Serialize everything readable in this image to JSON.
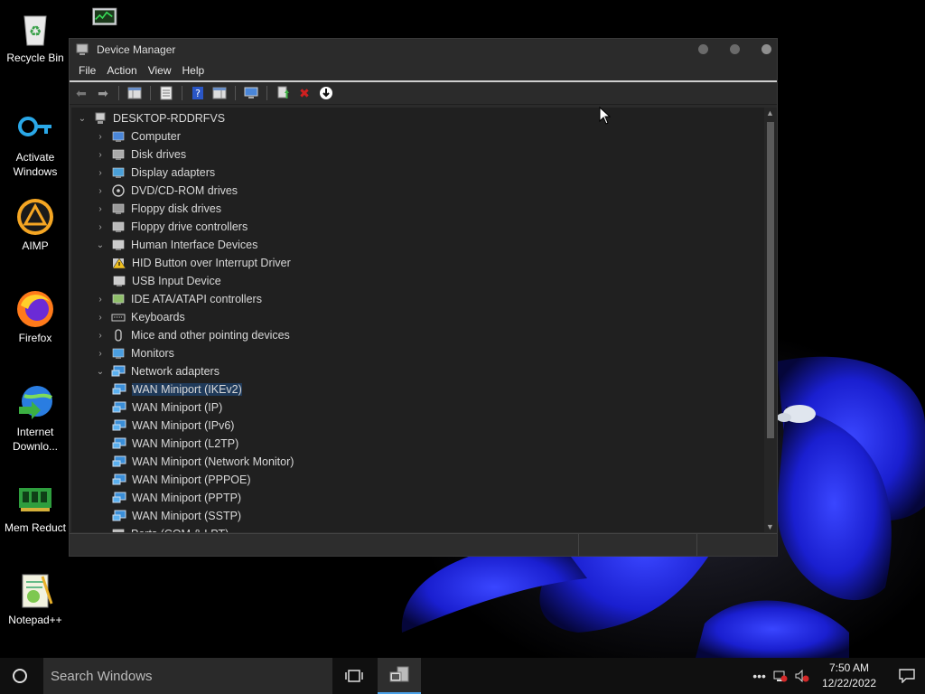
{
  "desktop": {
    "icons": [
      {
        "label": "Recycle Bin"
      },
      {
        "label": "Activate Windows"
      },
      {
        "label": "AIMP"
      },
      {
        "label": "Firefox"
      },
      {
        "label": "Internet Downlo..."
      },
      {
        "label": "Mem Reduct"
      },
      {
        "label": "Notepad++"
      }
    ]
  },
  "window": {
    "title": "Device Manager",
    "menu": [
      "File",
      "Action",
      "View",
      "Help"
    ],
    "tree": {
      "root": "DESKTOP-RDDRFVS",
      "items": [
        {
          "label": "Computer",
          "level": 1,
          "state": "collapsed",
          "icon": "computer-icon"
        },
        {
          "label": "Disk drives",
          "level": 1,
          "state": "collapsed",
          "icon": "disk-icon"
        },
        {
          "label": "Display adapters",
          "level": 1,
          "state": "collapsed",
          "icon": "display-icon"
        },
        {
          "label": "DVD/CD-ROM drives",
          "level": 1,
          "state": "collapsed",
          "icon": "dvd-icon"
        },
        {
          "label": "Floppy disk drives",
          "level": 1,
          "state": "collapsed",
          "icon": "floppy-icon"
        },
        {
          "label": "Floppy drive controllers",
          "level": 1,
          "state": "collapsed",
          "icon": "controller-icon"
        },
        {
          "label": "Human Interface Devices",
          "level": 1,
          "state": "expanded",
          "icon": "hid-icon"
        },
        {
          "label": "HID Button over Interrupt Driver",
          "level": 2,
          "state": "leaf",
          "icon": "warning-icon"
        },
        {
          "label": "USB Input Device",
          "level": 2,
          "state": "leaf",
          "icon": "hid-icon"
        },
        {
          "label": "IDE ATA/ATAPI controllers",
          "level": 1,
          "state": "collapsed",
          "icon": "ide-icon"
        },
        {
          "label": "Keyboards",
          "level": 1,
          "state": "collapsed",
          "icon": "keyboard-icon"
        },
        {
          "label": "Mice and other pointing devices",
          "level": 1,
          "state": "collapsed",
          "icon": "mouse-icon"
        },
        {
          "label": "Monitors",
          "level": 1,
          "state": "collapsed",
          "icon": "monitor-icon"
        },
        {
          "label": "Network adapters",
          "level": 1,
          "state": "expanded",
          "icon": "network-icon"
        },
        {
          "label": "WAN Miniport (IKEv2)",
          "level": 2,
          "state": "selected",
          "icon": "network-icon"
        },
        {
          "label": "WAN Miniport (IP)",
          "level": 2,
          "state": "leaf",
          "icon": "network-icon"
        },
        {
          "label": "WAN Miniport (IPv6)",
          "level": 2,
          "state": "leaf",
          "icon": "network-icon"
        },
        {
          "label": "WAN Miniport (L2TP)",
          "level": 2,
          "state": "leaf",
          "icon": "network-icon"
        },
        {
          "label": "WAN Miniport (Network Monitor)",
          "level": 2,
          "state": "leaf",
          "icon": "network-icon"
        },
        {
          "label": "WAN Miniport (PPPOE)",
          "level": 2,
          "state": "leaf",
          "icon": "network-icon"
        },
        {
          "label": "WAN Miniport (PPTP)",
          "level": 2,
          "state": "leaf",
          "icon": "network-icon"
        },
        {
          "label": "WAN Miniport (SSTP)",
          "level": 2,
          "state": "leaf",
          "icon": "network-icon"
        },
        {
          "label": "Ports (COM & LPT)",
          "level": 1,
          "state": "collapsed",
          "icon": "port-icon"
        }
      ]
    }
  },
  "taskbar": {
    "search_placeholder": "Search Windows",
    "time": "7:50 AM",
    "date": "12/22/2022"
  },
  "colors": {
    "window_bg": "#2b2b2b",
    "tree_bg": "#202020",
    "selection": "#1f3a5a",
    "taskbar": "#101010",
    "accent": "#4aa0e6"
  }
}
